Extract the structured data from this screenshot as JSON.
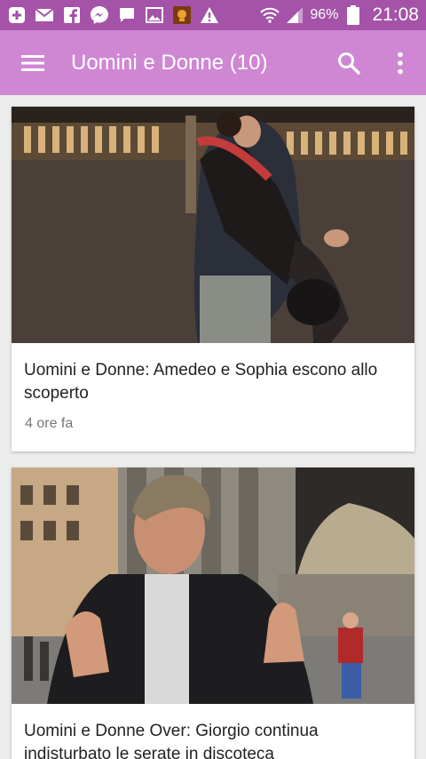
{
  "status_bar": {
    "icons": [
      "plus-box-icon",
      "mail-icon",
      "facebook-icon",
      "messenger-icon",
      "chat-icon",
      "image-icon",
      "app-notification-icon",
      "warning-icon"
    ],
    "battery_percent": "96%",
    "time": "21:08"
  },
  "app_bar": {
    "title": "Uomini e Donne (10)",
    "color": "#cf87d3",
    "status_color": "#a453a8"
  },
  "articles": [
    {
      "title": "Uomini e Donne: Amedeo e Sophia escono allo scoperto",
      "meta": "4 ore fa"
    },
    {
      "title": "Uomini e Donne Over: Giorgio continua indisturbato le serate in discoteca",
      "meta": ""
    }
  ]
}
